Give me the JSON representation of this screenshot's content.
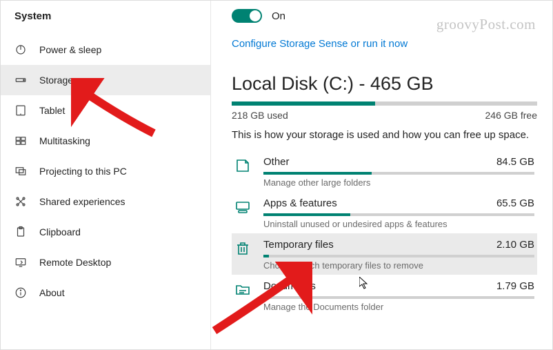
{
  "sidebar": {
    "title": "System",
    "items": [
      {
        "label": "Power & sleep"
      },
      {
        "label": "Storage"
      },
      {
        "label": "Tablet"
      },
      {
        "label": "Multitasking"
      },
      {
        "label": "Projecting to this PC"
      },
      {
        "label": "Shared experiences"
      },
      {
        "label": "Clipboard"
      },
      {
        "label": "Remote Desktop"
      },
      {
        "label": "About"
      }
    ]
  },
  "main": {
    "toggle_state": "On",
    "configure_link": "Configure Storage Sense or run it now",
    "disk_title": "Local Disk (C:) - 465 GB",
    "disk_used": "218 GB used",
    "disk_free": "246 GB free",
    "disk_fill_pct": 47,
    "intro": "This is how your storage is used and how you can free up space.",
    "categories": [
      {
        "name": "Other",
        "size": "84.5 GB",
        "sub": "Manage other large folders",
        "pct": 40
      },
      {
        "name": "Apps & features",
        "size": "65.5 GB",
        "sub": "Uninstall unused or undesired apps & features",
        "pct": 32
      },
      {
        "name": "Temporary files",
        "size": "2.10 GB",
        "sub": "Choose which temporary files to remove",
        "pct": 2
      },
      {
        "name": "Documents",
        "size": "1.79 GB",
        "sub": "Manage the Documents folder",
        "pct": 2
      }
    ]
  },
  "watermark": "groovyPost.com"
}
